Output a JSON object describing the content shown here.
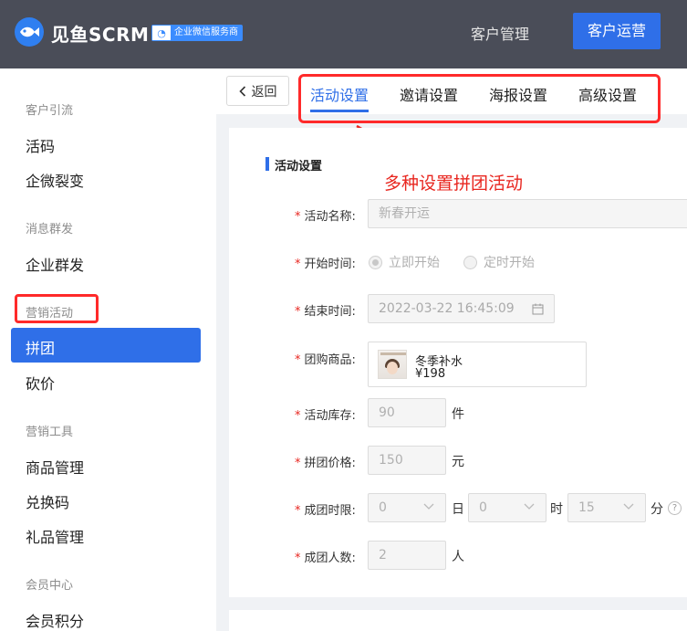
{
  "header": {
    "brand": "见鱼SCRM",
    "badge": "企业微信服务商",
    "nav_customer": "客户管理",
    "nav_ops": "客户运营"
  },
  "sidebar": {
    "groups": [
      {
        "title": "客户引流",
        "items": [
          "活码",
          "企微裂变"
        ]
      },
      {
        "title": "消息群发",
        "items": [
          "企业群发"
        ]
      },
      {
        "title": "营销活动",
        "items": [
          "拼团",
          "砍价"
        ]
      },
      {
        "title": "营销工具",
        "items": [
          "商品管理",
          "兑换码",
          "礼品管理"
        ]
      },
      {
        "title": "会员中心",
        "items": [
          "会员积分"
        ]
      }
    ],
    "active_item": "拼团"
  },
  "tabbar": {
    "back_label": "返回",
    "tabs": [
      "活动设置",
      "邀请设置",
      "海报设置",
      "高级设置"
    ],
    "active_tab": "活动设置"
  },
  "form": {
    "section_title": "活动设置",
    "annotation": "多种设置拼团活动",
    "activity_name": {
      "label": "活动名称:",
      "placeholder": "新春开运"
    },
    "start_time": {
      "label": "开始时间:",
      "options": [
        "立即开始",
        "定时开始"
      ],
      "selected": "立即开始"
    },
    "end_time": {
      "label": "结束时间:",
      "value": "2022-03-22 16:45:09"
    },
    "product": {
      "label": "团购商品:",
      "name": "冬季补水",
      "price": "¥198"
    },
    "stock": {
      "label": "活动库存:",
      "value": "90",
      "unit": "件"
    },
    "price": {
      "label": "拼团价格:",
      "value": "150",
      "unit": "元"
    },
    "time_limit": {
      "label": "成团时限:",
      "day": "0",
      "day_unit": "日",
      "hour": "0",
      "hour_unit": "时",
      "minute": "15",
      "minute_unit": "分"
    },
    "group_size": {
      "label": "成团人数:",
      "value": "2",
      "unit": "人"
    }
  },
  "colors": {
    "primary": "#2f6fe8",
    "topbar": "#4a4d58",
    "highlight_red": "#ff2a2a",
    "annotation_red": "#e8261f"
  }
}
